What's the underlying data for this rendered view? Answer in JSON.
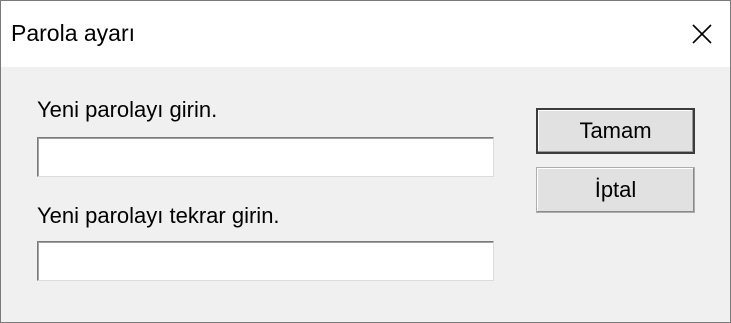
{
  "window": {
    "title": "Parola ayarı"
  },
  "icons": {
    "close": "close-icon"
  },
  "form": {
    "new_password_label": "Yeni parolayı girin.",
    "new_password_value": "",
    "confirm_password_label": "Yeni parolayı tekrar girin.",
    "confirm_password_value": ""
  },
  "buttons": {
    "ok_label": "Tamam",
    "cancel_label": "İptal"
  },
  "colors": {
    "dialog_background": "#f0f0f0",
    "titlebar_background": "#ffffff",
    "button_face": "#e1e1e1",
    "default_button_border": "#3c3c3c"
  }
}
